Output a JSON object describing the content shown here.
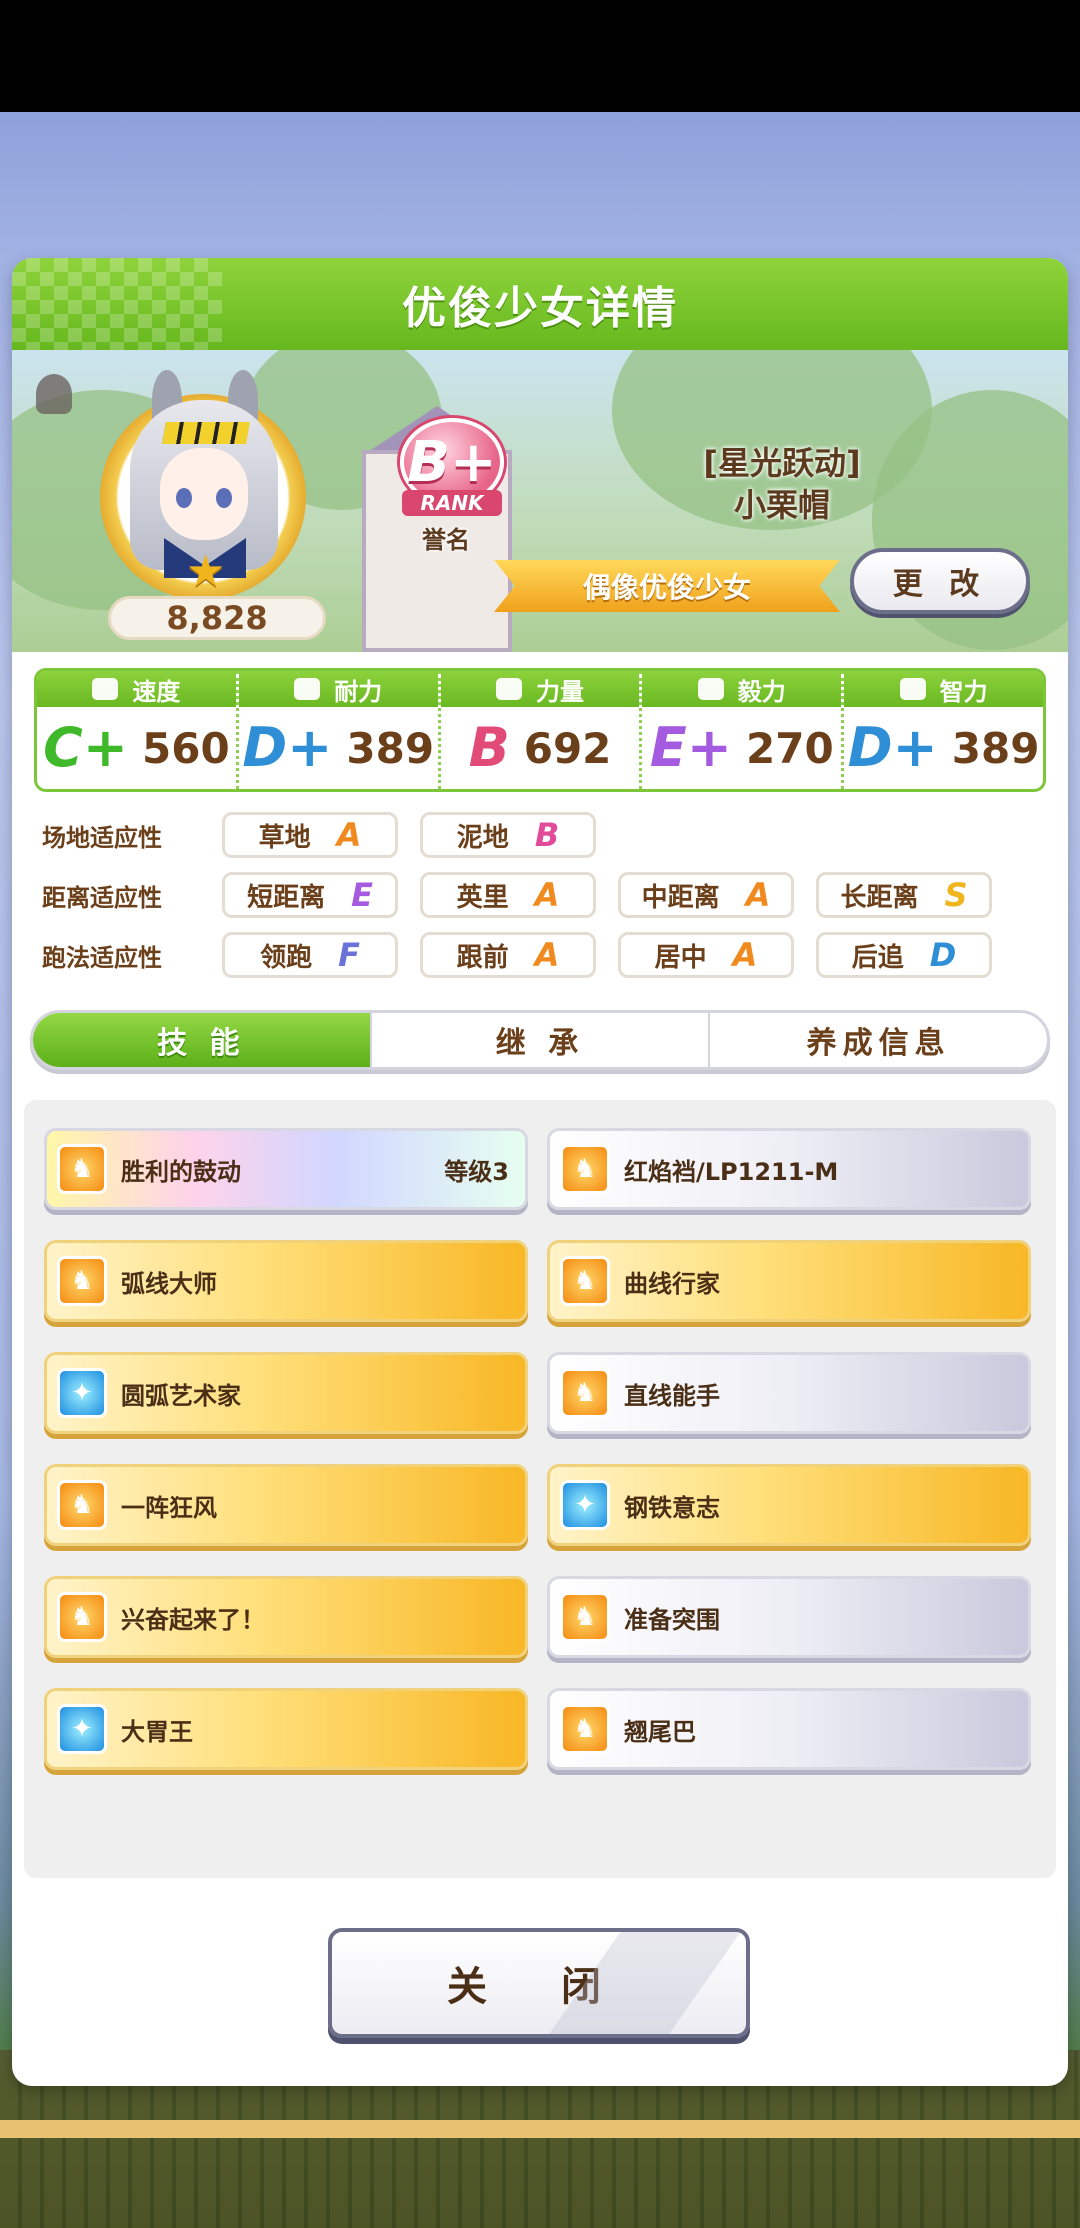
{
  "panel": {
    "title": "优俊少女详情"
  },
  "profile": {
    "fan_count": "8,828",
    "rank": {
      "letter": "B+",
      "label": "RANK",
      "caption": "誉名"
    },
    "epithet": "[星光跃动]",
    "name": "小栗帽",
    "title_ribbon": "偶像优俊少女",
    "change_button": "更 改"
  },
  "stats": [
    {
      "label": "速度",
      "icon": "shoe-icon",
      "grade": "C+",
      "value": "560",
      "color": "#3fb82a"
    },
    {
      "label": "耐力",
      "icon": "heart-icon",
      "grade": "D+",
      "value": "389",
      "color": "#2e8fd6"
    },
    {
      "label": "力量",
      "icon": "muscle-icon",
      "grade": "B",
      "value": "692",
      "color": "#e24b78"
    },
    {
      "label": "毅力",
      "icon": "flame-icon",
      "grade": "E+",
      "value": "270",
      "color": "#a45be0"
    },
    {
      "label": "智力",
      "icon": "graduation-cap-icon",
      "grade": "D+",
      "value": "389",
      "color": "#2e8fd6"
    }
  ],
  "aptitude": {
    "surface": {
      "label": "场地适应性",
      "items": [
        {
          "name": "草地",
          "grade": "A"
        },
        {
          "name": "泥地",
          "grade": "B"
        }
      ]
    },
    "distance": {
      "label": "距离适应性",
      "items": [
        {
          "name": "短距离",
          "grade": "E"
        },
        {
          "name": "英里",
          "grade": "A"
        },
        {
          "name": "中距离",
          "grade": "A"
        },
        {
          "name": "长距离",
          "grade": "S"
        }
      ]
    },
    "strategy": {
      "label": "跑法适应性",
      "items": [
        {
          "name": "领跑",
          "grade": "F"
        },
        {
          "name": "跟前",
          "grade": "A"
        },
        {
          "name": "居中",
          "grade": "A"
        },
        {
          "name": "后追",
          "grade": "D"
        }
      ]
    }
  },
  "grade_colors": {
    "S": "#f0b41c",
    "A": "#f08a1e",
    "B": "#e24b9a",
    "C": "#3fb82a",
    "D": "#2e8fd6",
    "E": "#a45be0",
    "F": "#6a72d8"
  },
  "tabs": [
    {
      "label": "技 能",
      "active": true
    },
    {
      "label": "继 承",
      "active": false
    },
    {
      "label": "养成信息",
      "active": false
    }
  ],
  "skills": [
    {
      "name": "胜利的鼓动",
      "level": "等级3",
      "style": "rainbow",
      "icon": "horse-skill-icon",
      "icon_color": "orange"
    },
    {
      "name": "红焰裆/LP1211-M",
      "level": "",
      "style": "white",
      "icon": "horse-skill-icon",
      "icon_color": "orange"
    },
    {
      "name": "弧线大师",
      "level": "",
      "style": "gold",
      "icon": "horse-skill-icon",
      "icon_color": "orange"
    },
    {
      "name": "曲线行家",
      "level": "",
      "style": "gold",
      "icon": "horse-skill-icon",
      "icon_color": "orange"
    },
    {
      "name": "圆弧艺术家",
      "level": "",
      "style": "gold",
      "icon": "sparkle-skill-icon",
      "icon_color": "blue"
    },
    {
      "name": "直线能手",
      "level": "",
      "style": "white",
      "icon": "horse-skill-icon",
      "icon_color": "orange"
    },
    {
      "name": "一阵狂风",
      "level": "",
      "style": "gold",
      "icon": "horse-skill-icon",
      "icon_color": "orange"
    },
    {
      "name": "钢铁意志",
      "level": "",
      "style": "gold",
      "icon": "sparkle-skill-icon",
      "icon_color": "blue"
    },
    {
      "name": "兴奋起来了！",
      "level": "",
      "style": "gold",
      "icon": "horse-skill-icon",
      "icon_color": "orange"
    },
    {
      "name": "准备突围",
      "level": "",
      "style": "white",
      "icon": "horse-skill-icon",
      "icon_color": "orange"
    },
    {
      "name": "大胃王",
      "level": "",
      "style": "gold",
      "icon": "sparkle-skill-icon",
      "icon_color": "blue"
    },
    {
      "name": "翘尾巴",
      "level": "",
      "style": "white",
      "icon": "horse-skill-icon",
      "icon_color": "orange"
    }
  ],
  "close_button": "关 闭"
}
